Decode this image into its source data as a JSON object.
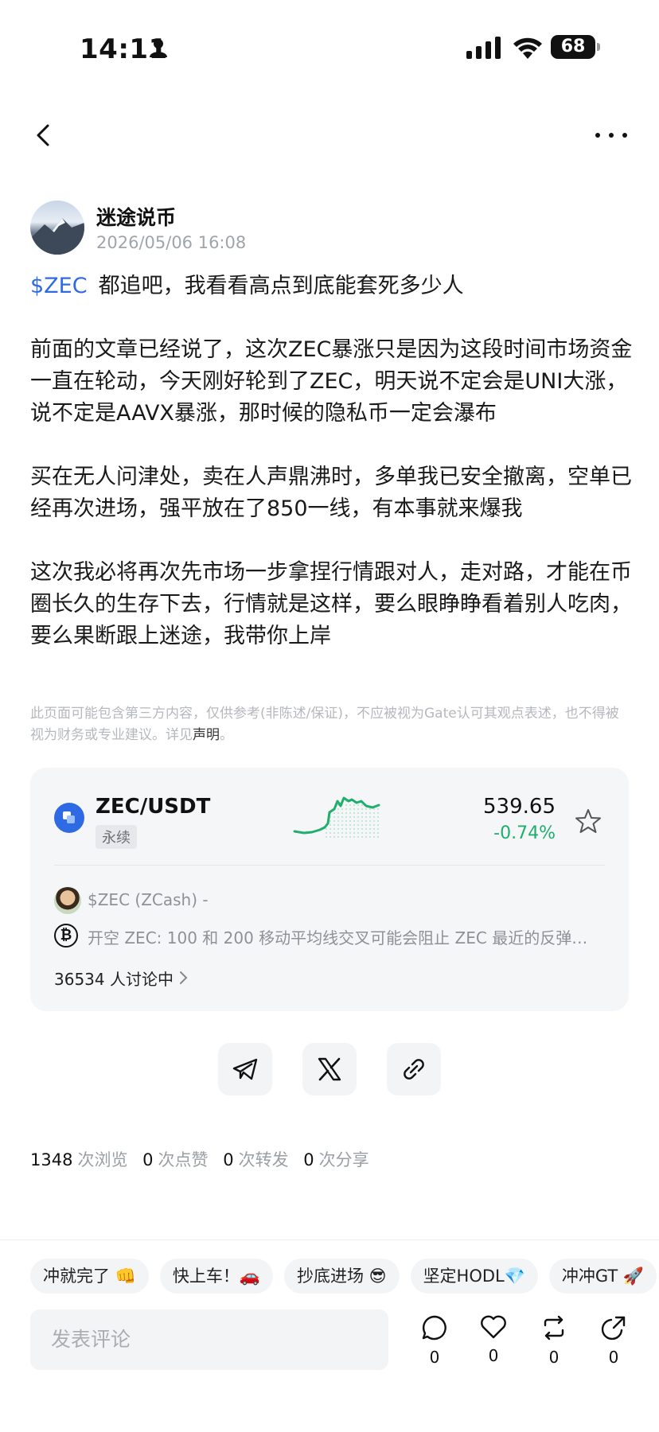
{
  "status_bar": {
    "time": "14:11",
    "battery": "68"
  },
  "author": {
    "name": "迷途说币",
    "time": "2026/05/06 16:08"
  },
  "post": {
    "tag": "$ZEC",
    "first_line": "都追吧，我看看高点到底能套死多少人",
    "paragraphs": [
      "前面的文章已经说了，这次ZEC暴涨只是因为这段时间市场资金一直在轮动，今天刚好轮到了ZEC，明天说不定会是UNI大涨，说不定是AAVX暴涨，那时候的隐私币一定会瀑布",
      "买在无人问津处，卖在人声鼎沸时，多单我已安全撤离，空单已经再次进场，强平放在了850一线，有本事就来爆我",
      "这次我必将再次先市场一步拿捏行情跟对人，走对路，才能在币圈长久的生存下去，行情就是这样，要么眼睁睁看着别人吃肉，要么果断跟上迷途，我带你上岸"
    ]
  },
  "disclaimer": {
    "text": "此页面可能包含第三方内容，仅供参考(非陈述/保证)，不应被视为Gate认可其观点表述，也不得被视为财务或专业建议。详见",
    "link": "声明",
    "end": "。"
  },
  "market_card": {
    "pair": "ZEC/USDT",
    "type": "永续",
    "price": "539.65",
    "change": "-0.74%",
    "change_color": "#1fae6b",
    "discussion_title": "$ZEC (ZCash) -",
    "discussion_text": "开空 ZEC: 100 和 200 移动平均线交叉可能会阻止 ZEC 最近的反弹，...",
    "discussion_count": "36534 人讨论中"
  },
  "share": [
    "telegram-icon",
    "x-icon",
    "link-icon"
  ],
  "stats": [
    {
      "num": "1348",
      "label": "次浏览"
    },
    {
      "num": "0",
      "label": "次点赞"
    },
    {
      "num": "0",
      "label": "次转发"
    },
    {
      "num": "0",
      "label": "次分享"
    }
  ],
  "quick_replies": [
    "冲就完了 👊",
    "快上车！🚗",
    "抄底进场 😎",
    "坚定HODL💎",
    "冲冲GT 🚀"
  ],
  "comment_placeholder": "发表评论",
  "actions": {
    "comment": "0",
    "like": "0",
    "repost": "0",
    "share": "0"
  }
}
